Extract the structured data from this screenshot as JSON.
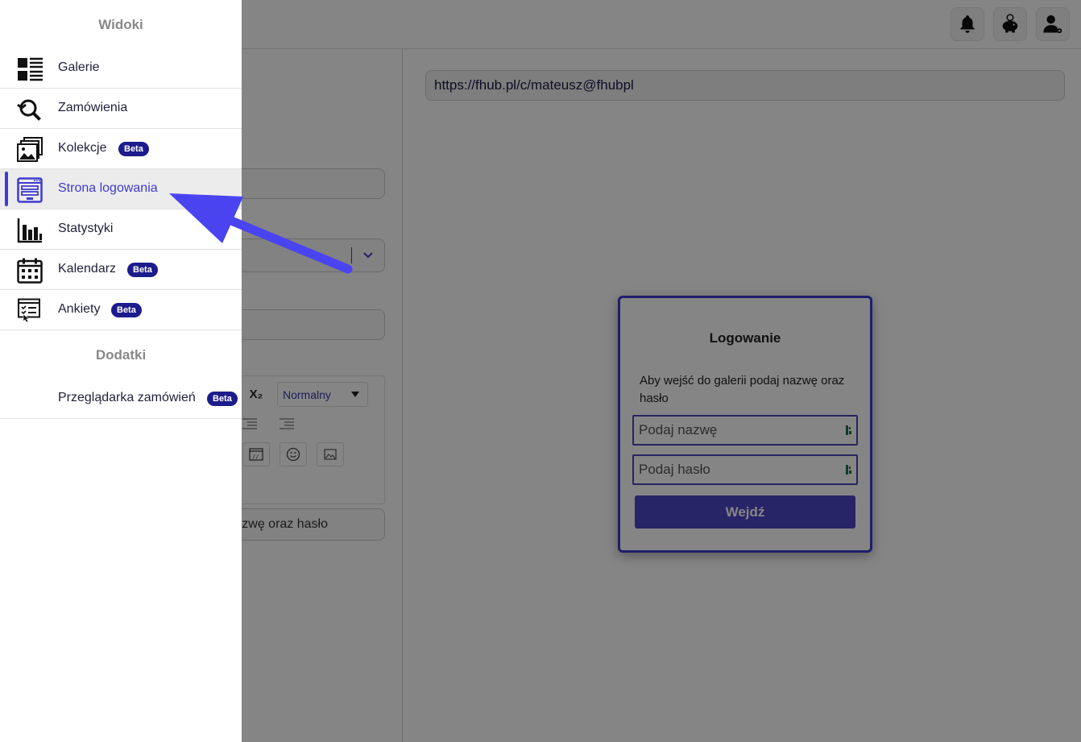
{
  "sidebar": {
    "section_views": "Widoki",
    "items": [
      {
        "label": "Galerie",
        "icon": "galleries-icon"
      },
      {
        "label": "Zamówienia",
        "icon": "orders-icon"
      },
      {
        "label": "Kolekcje",
        "icon": "collections-icon",
        "badge": "Beta"
      },
      {
        "label": "Strona logowania",
        "icon": "login-page-icon",
        "active": true
      },
      {
        "label": "Statystyki",
        "icon": "statistics-icon"
      },
      {
        "label": "Kalendarz",
        "icon": "calendar-icon",
        "badge": "Beta"
      },
      {
        "label": "Ankiety",
        "icon": "survey-icon",
        "badge": "Beta"
      }
    ],
    "section_addons": "Dodatki",
    "addons": [
      {
        "label": "Przeglądarka zamówień",
        "badge": "Beta"
      }
    ]
  },
  "header": {
    "buttons": [
      "bell-icon",
      "piggy-bank-icon",
      "user-settings-icon"
    ]
  },
  "editor": {
    "subscript": "X₂",
    "format_select": "Normalny",
    "subtitle_value": "nazwę oraz hasło"
  },
  "preview": {
    "url": "https://fhub.pl/c/mateusz@fhubpl",
    "login_title": "Logowanie",
    "login_description": "Aby wejść do galerii podaj nazwę oraz hasło",
    "name_placeholder": "Podaj nazwę",
    "password_placeholder": "Podaj hasło",
    "submit_label": "Wejdź"
  },
  "colors": {
    "accent": "#3f3bd0",
    "badge": "#1c1c8c",
    "arrow": "#4a44f0"
  }
}
